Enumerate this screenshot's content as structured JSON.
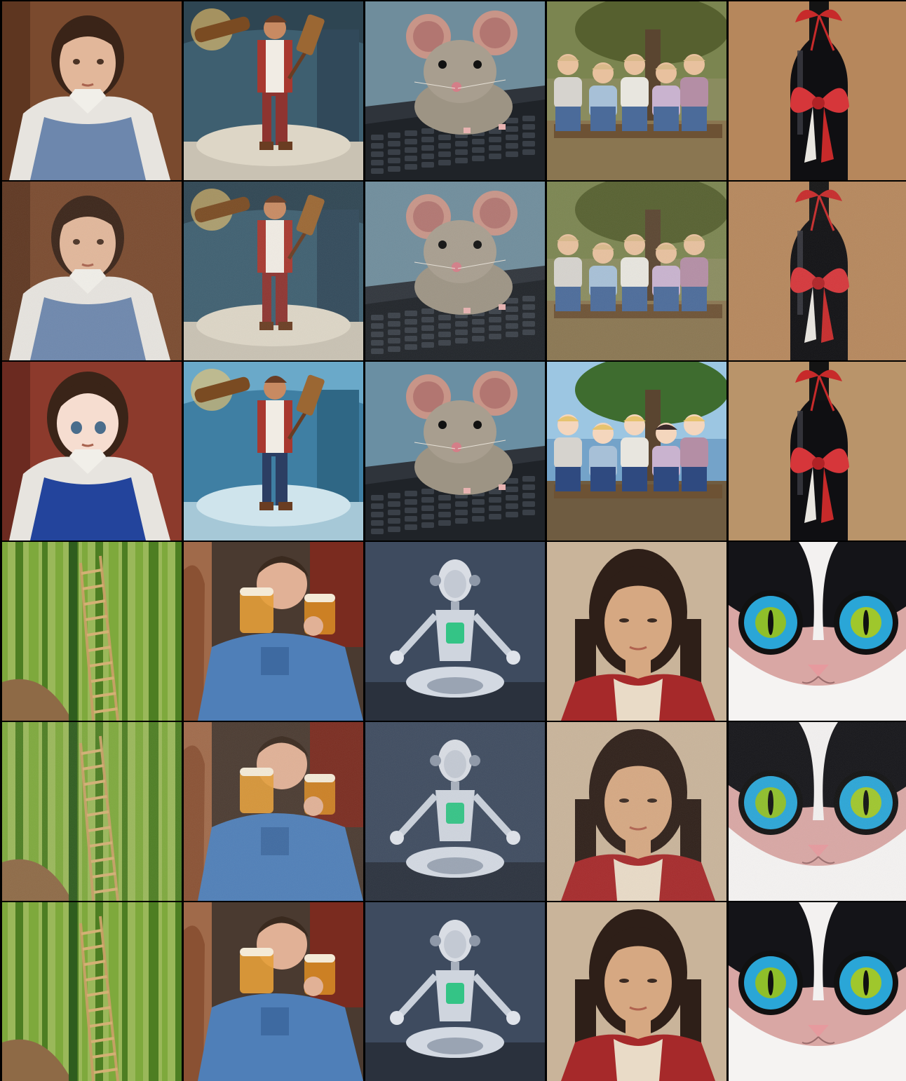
{
  "grid": {
    "rows": 6,
    "columns": 5,
    "block_1": {
      "subjects": [
        "girl-portrait",
        "man-with-mallets",
        "mouse-on-laptop",
        "children-on-bench",
        "wine-bottle-with-ribbon"
      ],
      "row_styles": [
        "painting",
        "painting-noisy",
        "anime"
      ]
    },
    "block_2": {
      "subjects": [
        "bamboo-ladder",
        "man-drinking-beer",
        "meditating-robot",
        "woman-portrait",
        "cat-with-glasses"
      ],
      "row_styles": [
        "photo",
        "photo-noisy",
        "illustration"
      ]
    }
  },
  "colors": {
    "border": "#000000",
    "brown_bg": "#7a4a2e",
    "blue_scene": "#3f6d8c",
    "laptop_gray": "#55606b",
    "park_green": "#6b7440",
    "tan_bg": "#b8875e",
    "bamboo_green": "#6e9a32",
    "robot_bg": "#3d4c63",
    "beige_bg": "#c9b49a",
    "cat_pink": "#d9a7a4"
  }
}
